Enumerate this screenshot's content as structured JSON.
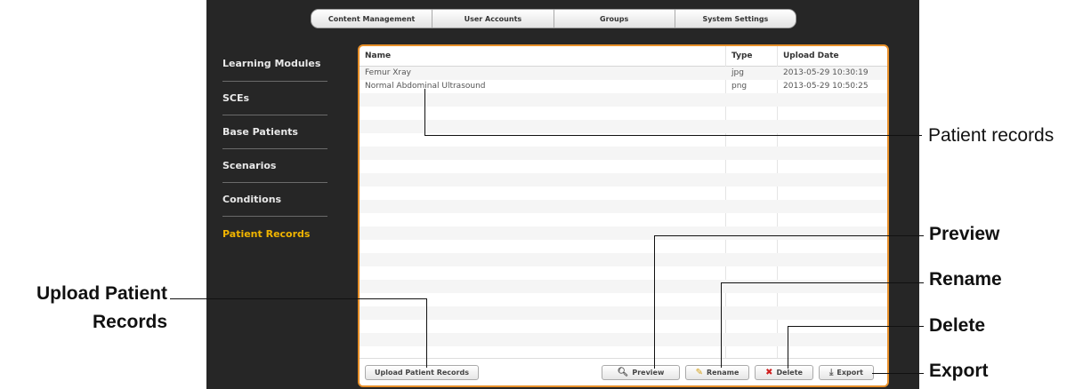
{
  "tabs": [
    "Content Management",
    "User Accounts",
    "Groups",
    "System Settings"
  ],
  "sidebar": {
    "items": [
      "Learning Modules",
      "SCEs",
      "Base Patients",
      "Scenarios",
      "Conditions",
      "Patient Records"
    ],
    "active_index": 5,
    "active_color": "#f0b400"
  },
  "table": {
    "columns": [
      "Name",
      "Type",
      "Upload Date"
    ],
    "rows": [
      {
        "name": "Femur Xray",
        "type": "jpg",
        "date": "2013-05-29 10:30:19"
      },
      {
        "name": "Normal Abdominal Ultrasound",
        "type": "png",
        "date": "2013-05-29 10:50:25"
      }
    ]
  },
  "buttons": {
    "upload": "Upload Patient Records",
    "preview": "Preview",
    "rename": "Rename",
    "delete": "Delete",
    "export": "Export"
  },
  "icons": {
    "preview": "magnifier-icon",
    "rename": "pencil-icon",
    "delete": "x-icon",
    "export": "download-icon"
  },
  "annotations": {
    "patient_records": "Patient records",
    "preview": "Preview",
    "rename": "Rename",
    "upload_line1": "Upload Patient",
    "upload_line2": "Records",
    "delete": "Delete",
    "export": "Export"
  },
  "colors": {
    "panel_border": "#e8902a",
    "app_background": "#262626"
  }
}
